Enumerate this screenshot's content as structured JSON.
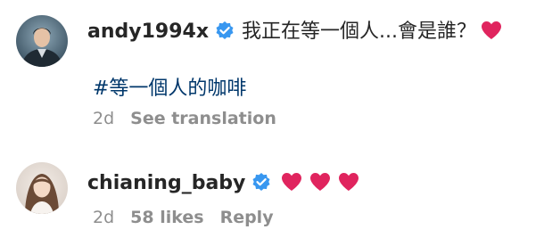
{
  "comments": [
    {
      "username": "andy1994x",
      "verified": true,
      "text": "我正在等一個人...會是誰？",
      "hashtag": "#等一個人的咖啡",
      "time": "2d",
      "actions": [
        "See translation"
      ]
    },
    {
      "username": "chianing_baby",
      "verified": true,
      "hearts": 3,
      "time": "2d",
      "likes": "58 likes",
      "actions": [
        "Reply"
      ]
    }
  ],
  "colors": {
    "text": "#262626",
    "meta": "#8e8e8e",
    "hashtag": "#00376b",
    "verified": "#3897f0",
    "heart": "#e0245e"
  },
  "icons": [
    "verified-badge-icon",
    "heart-emoji-icon"
  ]
}
